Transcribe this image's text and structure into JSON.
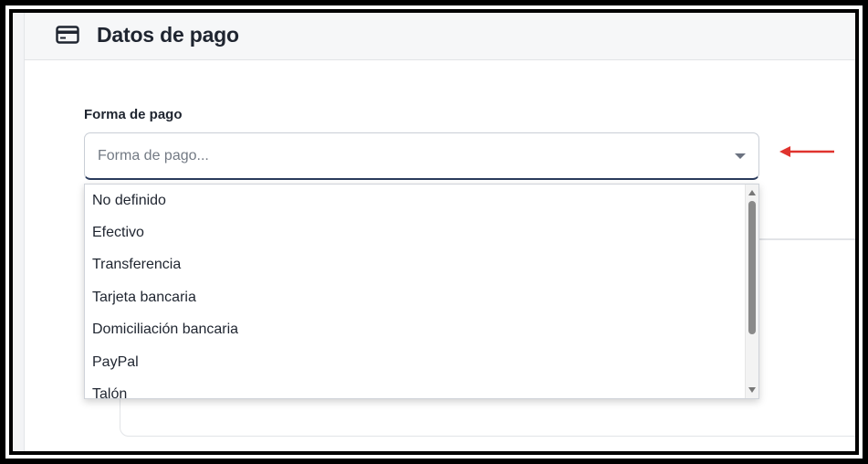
{
  "header": {
    "title": "Datos de pago",
    "icon": "credit-card-icon"
  },
  "field": {
    "label": "Forma de pago",
    "placeholder": "Forma de pago...",
    "caret_icon": "caret-down-icon"
  },
  "dropdown": {
    "options": [
      "No definido",
      "Efectivo",
      "Transferencia",
      "Tarjeta bancaria",
      "Domiciliación bancaria",
      "PayPal",
      "Talón"
    ]
  },
  "annotation": {
    "icon": "red-arrow-icon",
    "color": "#e0332e"
  },
  "colors": {
    "header_bg": "#f6f7f8",
    "title_text": "#1f2530",
    "select_focus_border": "#2a3b5c",
    "placeholder": "#737a84"
  }
}
